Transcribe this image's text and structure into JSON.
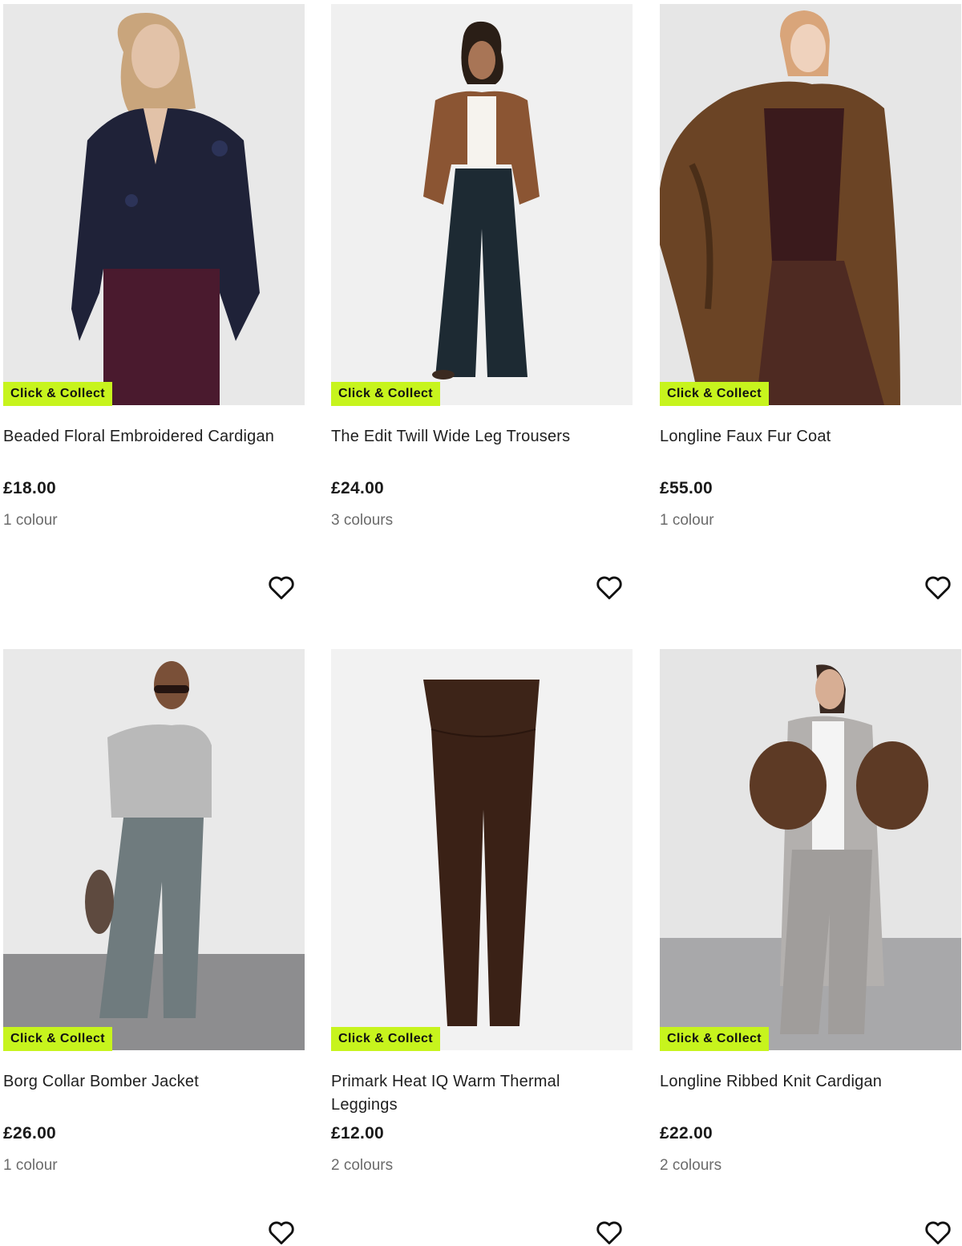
{
  "products": [
    {
      "badge": "Click & Collect",
      "title": "Beaded Floral Embroidered Cardigan",
      "price": "£18.00",
      "colours": "1 colour",
      "image_icon": "cardigan-photo"
    },
    {
      "badge": "Click & Collect",
      "title": "The Edit Twill Wide Leg Trousers",
      "price": "£24.00",
      "colours": "3 colours",
      "image_icon": "trousers-photo"
    },
    {
      "badge": "Click & Collect",
      "title": "Longline Faux Fur Coat",
      "price": "£55.00",
      "colours": "1 colour",
      "image_icon": "fur-coat-photo"
    },
    {
      "badge": "Click & Collect",
      "title": "Borg Collar Bomber Jacket",
      "price": "£26.00",
      "colours": "1 colour",
      "image_icon": "bomber-jacket-photo"
    },
    {
      "badge": "Click & Collect",
      "title": "Primark Heat IQ Warm Thermal Leggings",
      "price": "£12.00",
      "colours": "2 colours",
      "image_icon": "leggings-photo"
    },
    {
      "badge": "Click & Collect",
      "title": "Longline Ribbed Knit Cardigan",
      "price": "£22.00",
      "colours": "2 colours",
      "image_icon": "knit-cardigan-photo"
    }
  ],
  "colors": {
    "badge_bg": "#c7f41d",
    "muted_text": "#6b6b6b"
  },
  "icons": {
    "wishlist": "heart-outline-icon"
  }
}
